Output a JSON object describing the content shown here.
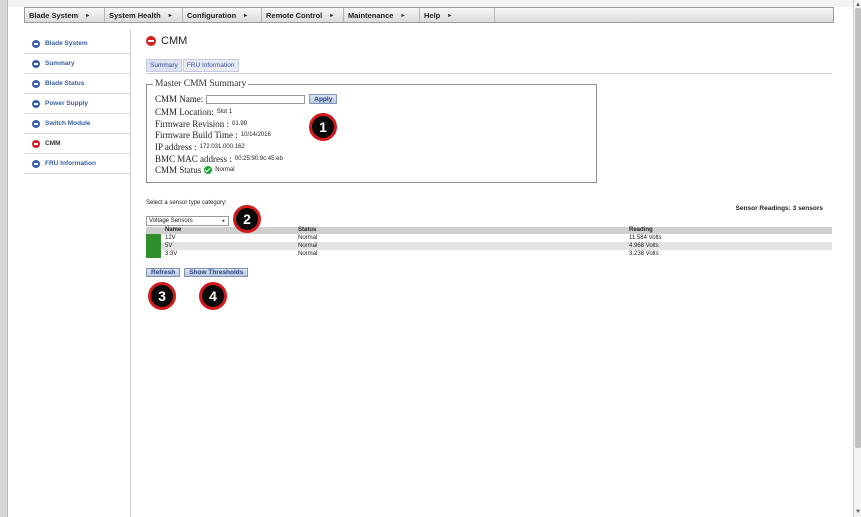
{
  "menubar": {
    "items": [
      {
        "label": "Blade System"
      },
      {
        "label": "System Health"
      },
      {
        "label": "Configuration"
      },
      {
        "label": "Remote Control"
      },
      {
        "label": "Maintenance"
      },
      {
        "label": "Help"
      }
    ],
    "arrow_glyph": "▸"
  },
  "sidebar": {
    "items": [
      {
        "label": "Blade System",
        "icon": "blue-circle-icon"
      },
      {
        "label": "Summary",
        "icon": "blue-circle-icon"
      },
      {
        "label": "Blade Status",
        "icon": "blue-circle-icon"
      },
      {
        "label": "Power Supply",
        "icon": "blue-circle-icon"
      },
      {
        "label": "Switch Module",
        "icon": "blue-circle-icon"
      },
      {
        "label": "CMM",
        "icon": "red-circle-icon",
        "active": true
      },
      {
        "label": "FRU Information",
        "icon": "blue-circle-icon"
      }
    ]
  },
  "page": {
    "title": "CMM",
    "tabs": [
      {
        "label": "Summary"
      },
      {
        "label": "FRU Information"
      }
    ]
  },
  "summary": {
    "legend": "Master CMM Summary",
    "name_label": "CMM Name:",
    "name_value": "",
    "apply_label": "Apply",
    "location_label": "CMM Location:",
    "location_value": "Slot 1",
    "fw_rev_label": "Firmware Revision :",
    "fw_rev_value": "01.99",
    "fw_time_label": "Firmware Build Time :",
    "fw_time_value": "10/14/2016",
    "ip_label": "IP address :",
    "ip_value": "172.031.000.162",
    "mac_label": "BMC MAC address :",
    "mac_value": "00:25:90:9c:45:eb",
    "status_label": "CMM Status",
    "status_value": "Normal"
  },
  "sensors": {
    "prompt": "Select a sensor type category:",
    "count_text": "Sensor Readings: 3 sensors",
    "selected_category": "Voltage Sensors",
    "columns": {
      "name": "Name",
      "status": "Status",
      "reading": "Reading"
    },
    "rows": [
      {
        "name": "12V",
        "status": "Normal",
        "reading": "11.584 Volts"
      },
      {
        "name": "5V",
        "status": "Normal",
        "reading": "4.968 Volts"
      },
      {
        "name": "3.3V",
        "status": "Normal",
        "reading": "3.238 Volts"
      }
    ],
    "refresh_label": "Refresh",
    "thresholds_label": "Show Thresholds"
  },
  "callouts": [
    "1",
    "2",
    "3",
    "4"
  ],
  "colors": {
    "accent_blue": "#3a5fa5",
    "cmm_red": "#d42020",
    "sensor_ok_green": "#2f8f2f",
    "callout_border": "#d21b1b"
  }
}
